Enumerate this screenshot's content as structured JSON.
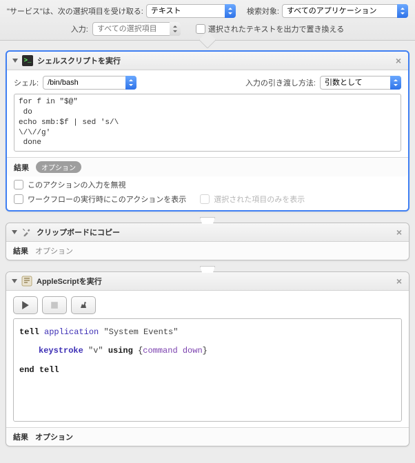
{
  "topbar": {
    "receive_label": "\"サービス\"は、次の選択項目を受け取る:",
    "receive_value": "テキスト",
    "target_label": "検索対象:",
    "target_value": "すべてのアプリケーション",
    "input_label": "入力:",
    "input_value": "すべての選択項目",
    "replace_label": "選択されたテキストを出力で置き換える"
  },
  "actions": {
    "shell": {
      "title": "シェルスクリプトを実行",
      "shell_label": "シェル:",
      "shell_value": "/bin/bash",
      "pass_label": "入力の引き渡し方法:",
      "pass_value": "引数として",
      "script": "for f in \"$@\"\n do\necho smb:$f | sed 's/\\\n\\/\\//g'\n done",
      "ignore_input_label": "このアクションの入力を無視",
      "show_at_run_label": "ワークフローの実行時にこのアクションを表示",
      "show_selected_only_label": "選択された項目のみを表示"
    },
    "clipboard": {
      "title": "クリップボードにコピー"
    },
    "applescript": {
      "title": "AppleScriptを実行",
      "lines": {
        "l1a": "tell",
        "l1b": "application",
        "l1c": "\"System Events\"",
        "l2a": "keystroke",
        "l2b": "\"v\"",
        "l2c": "using",
        "l2d": "{",
        "l2e": "command down",
        "l2f": "}",
        "l3a": "end",
        "l3b": "tell"
      }
    },
    "footer": {
      "results": "結果",
      "options": "オプション"
    }
  }
}
